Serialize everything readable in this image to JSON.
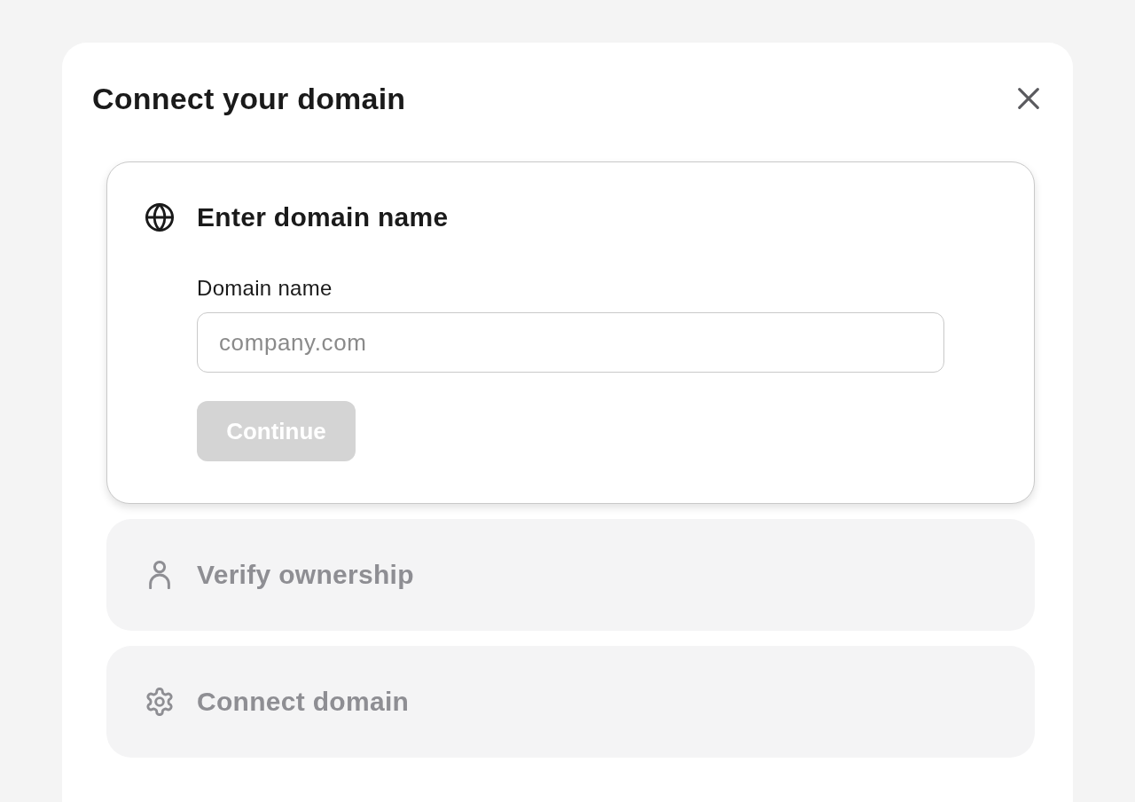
{
  "dialog": {
    "title": "Connect your domain"
  },
  "steps": [
    {
      "title": "Enter domain name",
      "expanded": true,
      "field": {
        "label": "Domain name",
        "placeholder": "company.com"
      },
      "button": {
        "label": "Continue",
        "disabled": true
      }
    },
    {
      "title": "Verify ownership",
      "expanded": false
    },
    {
      "title": "Connect domain",
      "expanded": false
    }
  ]
}
